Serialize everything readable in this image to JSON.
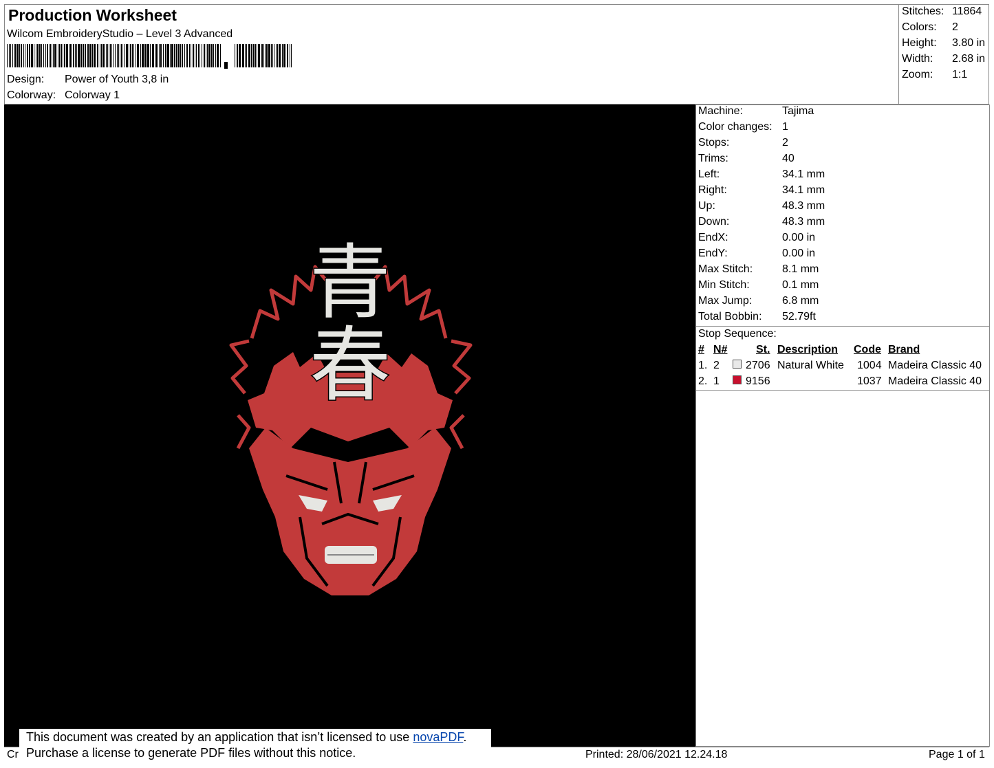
{
  "header": {
    "title": "Production Worksheet",
    "subtitle": "Wilcom EmbroideryStudio – Level 3 Advanced",
    "design_label": "Design:",
    "design_value": "Power of Youth 3,8 in",
    "colorway_label": "Colorway:",
    "colorway_value": "Colorway 1"
  },
  "stats": [
    {
      "label": "Stitches:",
      "value": "11864"
    },
    {
      "label": "Colors:",
      "value": "2"
    },
    {
      "label": "Height:",
      "value": "3.80 in"
    },
    {
      "label": "Width:",
      "value": "2.68 in"
    },
    {
      "label": "Zoom:",
      "value": "1:1"
    }
  ],
  "machine_info": [
    {
      "label": "Machine:",
      "value": "Tajima"
    },
    {
      "label": "Color changes:",
      "value": "1"
    },
    {
      "label": "Stops:",
      "value": "2"
    },
    {
      "label": "Trims:",
      "value": "40"
    },
    {
      "label": "Left:",
      "value": "34.1 mm"
    },
    {
      "label": "Right:",
      "value": "34.1 mm"
    },
    {
      "label": "Up:",
      "value": "48.3 mm"
    },
    {
      "label": "Down:",
      "value": "48.3 mm"
    },
    {
      "label": "EndX:",
      "value": "0.00 in"
    },
    {
      "label": "EndY:",
      "value": "0.00 in"
    },
    {
      "label": "Max Stitch:",
      "value": "8.1 mm"
    },
    {
      "label": "Min Stitch:",
      "value": "0.1 mm"
    },
    {
      "label": "Max Jump:",
      "value": "6.8 mm"
    },
    {
      "label": "Total Bobbin:",
      "value": "52.79ft"
    }
  ],
  "stop_sequence": {
    "title": "Stop Sequence:",
    "columns": {
      "num": "#",
      "needle": "N#",
      "stitches": "St.",
      "description": "Description",
      "code": "Code",
      "brand": "Brand"
    },
    "rows": [
      {
        "num": "1.",
        "needle": "2",
        "color": "#e9e9e9",
        "stitches": "2706",
        "description": "Natural White",
        "code": "1004",
        "brand": "Madeira Classic 40"
      },
      {
        "num": "2.",
        "needle": "1",
        "color": "#c8102e",
        "stitches": "9156",
        "description": "",
        "code": "1037",
        "brand": "Madeira Classic 40"
      }
    ]
  },
  "artwork": {
    "kanji_1": "青",
    "kanji_2": "春",
    "red": "#c23a3a",
    "white": "#e6e6e2"
  },
  "notice": {
    "line1_prefix": "This document was created by an application that isn’t licensed to use ",
    "link": "novaPDF",
    "line1_suffix": ".",
    "line2": "Purchase a license to generate PDF files without this notice."
  },
  "footer": {
    "left": "Cr",
    "printed": "Printed: 28/06/2021 12.24.18",
    "page": "Page 1 of 1"
  }
}
